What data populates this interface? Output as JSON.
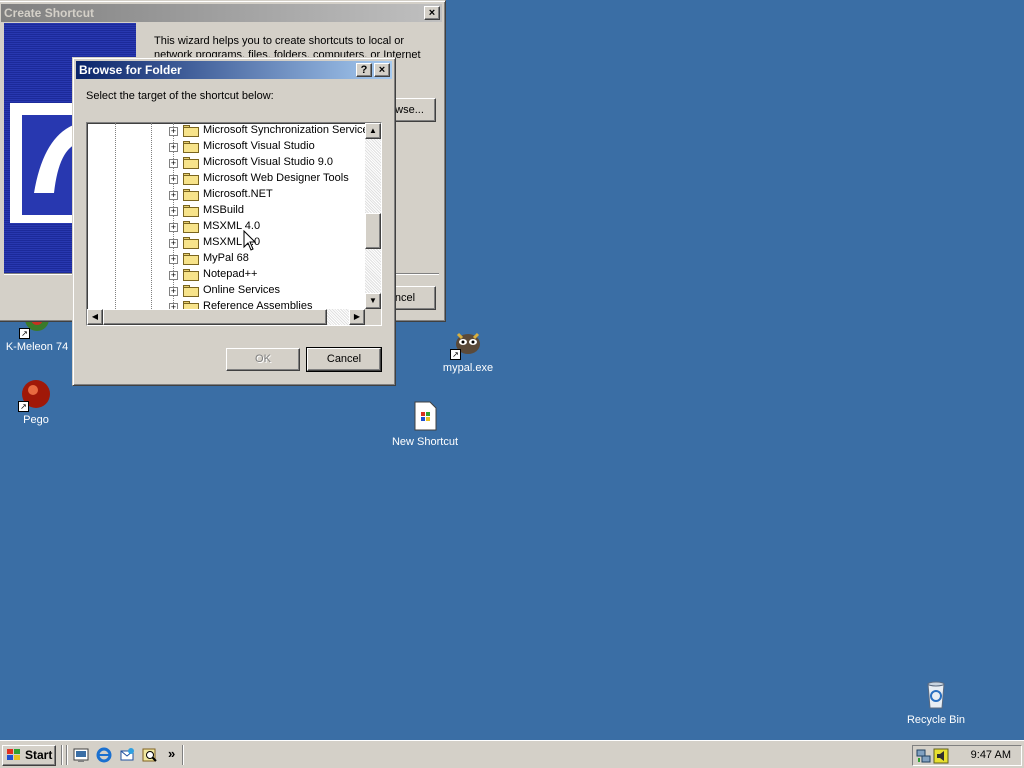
{
  "desktop": {
    "icons": [
      {
        "label": "K-Meleon 74",
        "icon": "k-meleon-icon"
      },
      {
        "label": "Pego",
        "icon": "pego-icon"
      },
      {
        "label": "mypal.exe",
        "icon": "mypal-icon"
      },
      {
        "label": "New Shortcut",
        "icon": "shortcut-file-icon"
      },
      {
        "label": "Recycle Bin",
        "icon": "recycle-bin-icon"
      }
    ]
  },
  "create_shortcut": {
    "title": "Create Shortcut",
    "close_label": "×",
    "description": "This wizard helps you to create shortcuts to local or network programs, files, folders, computers, or Internet",
    "browse_label": "Browse...",
    "cancel_label": "Cancel"
  },
  "browse_folder": {
    "title": "Browse for Folder",
    "help_label": "?",
    "close_label": "×",
    "prompt": "Select the target of the shortcut below:",
    "tree_items": [
      "Microsoft Synchronization Services",
      "Microsoft Visual Studio",
      "Microsoft Visual Studio 9.0",
      "Microsoft Web Designer Tools",
      "Microsoft.NET",
      "MSBuild",
      "MSXML 4.0",
      "MSXML 6.0",
      "MyPal 68",
      "Notepad++",
      "Online Services",
      "Reference Assemblies"
    ],
    "expander": "+",
    "ok_label": "OK",
    "cancel_label": "Cancel"
  },
  "taskbar": {
    "start_label": "Start",
    "quick_launch": [
      "show-desktop-icon",
      "internet-explorer-icon",
      "outlook-express-icon",
      "search-icon"
    ],
    "chevron": "»",
    "clock": "9:47 AM",
    "tray_icons": [
      "network-icon",
      "volume-icon"
    ]
  }
}
